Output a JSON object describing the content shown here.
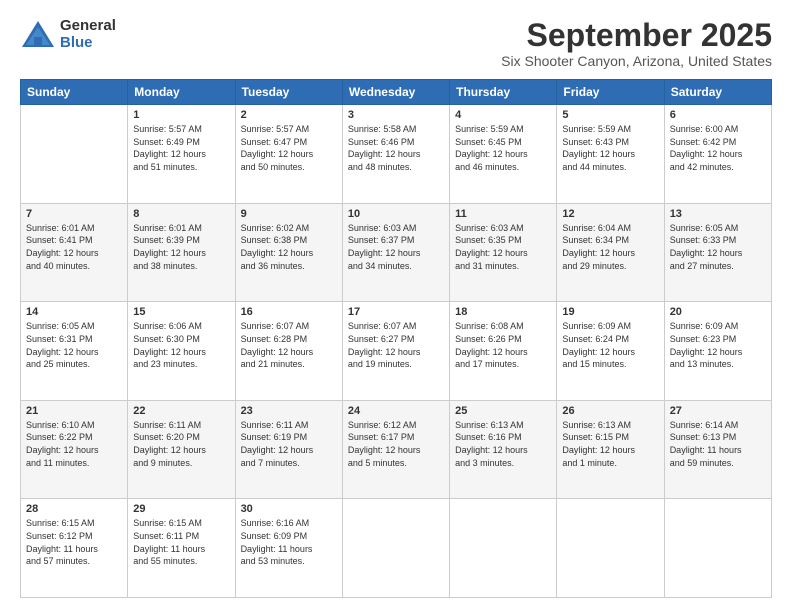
{
  "logo": {
    "general": "General",
    "blue": "Blue"
  },
  "title": "September 2025",
  "location": "Six Shooter Canyon, Arizona, United States",
  "days_of_week": [
    "Sunday",
    "Monday",
    "Tuesday",
    "Wednesday",
    "Thursday",
    "Friday",
    "Saturday"
  ],
  "weeks": [
    [
      {
        "day": "",
        "info": ""
      },
      {
        "day": "1",
        "info": "Sunrise: 5:57 AM\nSunset: 6:49 PM\nDaylight: 12 hours\nand 51 minutes."
      },
      {
        "day": "2",
        "info": "Sunrise: 5:57 AM\nSunset: 6:47 PM\nDaylight: 12 hours\nand 50 minutes."
      },
      {
        "day": "3",
        "info": "Sunrise: 5:58 AM\nSunset: 6:46 PM\nDaylight: 12 hours\nand 48 minutes."
      },
      {
        "day": "4",
        "info": "Sunrise: 5:59 AM\nSunset: 6:45 PM\nDaylight: 12 hours\nand 46 minutes."
      },
      {
        "day": "5",
        "info": "Sunrise: 5:59 AM\nSunset: 6:43 PM\nDaylight: 12 hours\nand 44 minutes."
      },
      {
        "day": "6",
        "info": "Sunrise: 6:00 AM\nSunset: 6:42 PM\nDaylight: 12 hours\nand 42 minutes."
      }
    ],
    [
      {
        "day": "7",
        "info": "Sunrise: 6:01 AM\nSunset: 6:41 PM\nDaylight: 12 hours\nand 40 minutes."
      },
      {
        "day": "8",
        "info": "Sunrise: 6:01 AM\nSunset: 6:39 PM\nDaylight: 12 hours\nand 38 minutes."
      },
      {
        "day": "9",
        "info": "Sunrise: 6:02 AM\nSunset: 6:38 PM\nDaylight: 12 hours\nand 36 minutes."
      },
      {
        "day": "10",
        "info": "Sunrise: 6:03 AM\nSunset: 6:37 PM\nDaylight: 12 hours\nand 34 minutes."
      },
      {
        "day": "11",
        "info": "Sunrise: 6:03 AM\nSunset: 6:35 PM\nDaylight: 12 hours\nand 31 minutes."
      },
      {
        "day": "12",
        "info": "Sunrise: 6:04 AM\nSunset: 6:34 PM\nDaylight: 12 hours\nand 29 minutes."
      },
      {
        "day": "13",
        "info": "Sunrise: 6:05 AM\nSunset: 6:33 PM\nDaylight: 12 hours\nand 27 minutes."
      }
    ],
    [
      {
        "day": "14",
        "info": "Sunrise: 6:05 AM\nSunset: 6:31 PM\nDaylight: 12 hours\nand 25 minutes."
      },
      {
        "day": "15",
        "info": "Sunrise: 6:06 AM\nSunset: 6:30 PM\nDaylight: 12 hours\nand 23 minutes."
      },
      {
        "day": "16",
        "info": "Sunrise: 6:07 AM\nSunset: 6:28 PM\nDaylight: 12 hours\nand 21 minutes."
      },
      {
        "day": "17",
        "info": "Sunrise: 6:07 AM\nSunset: 6:27 PM\nDaylight: 12 hours\nand 19 minutes."
      },
      {
        "day": "18",
        "info": "Sunrise: 6:08 AM\nSunset: 6:26 PM\nDaylight: 12 hours\nand 17 minutes."
      },
      {
        "day": "19",
        "info": "Sunrise: 6:09 AM\nSunset: 6:24 PM\nDaylight: 12 hours\nand 15 minutes."
      },
      {
        "day": "20",
        "info": "Sunrise: 6:09 AM\nSunset: 6:23 PM\nDaylight: 12 hours\nand 13 minutes."
      }
    ],
    [
      {
        "day": "21",
        "info": "Sunrise: 6:10 AM\nSunset: 6:22 PM\nDaylight: 12 hours\nand 11 minutes."
      },
      {
        "day": "22",
        "info": "Sunrise: 6:11 AM\nSunset: 6:20 PM\nDaylight: 12 hours\nand 9 minutes."
      },
      {
        "day": "23",
        "info": "Sunrise: 6:11 AM\nSunset: 6:19 PM\nDaylight: 12 hours\nand 7 minutes."
      },
      {
        "day": "24",
        "info": "Sunrise: 6:12 AM\nSunset: 6:17 PM\nDaylight: 12 hours\nand 5 minutes."
      },
      {
        "day": "25",
        "info": "Sunrise: 6:13 AM\nSunset: 6:16 PM\nDaylight: 12 hours\nand 3 minutes."
      },
      {
        "day": "26",
        "info": "Sunrise: 6:13 AM\nSunset: 6:15 PM\nDaylight: 12 hours\nand 1 minute."
      },
      {
        "day": "27",
        "info": "Sunrise: 6:14 AM\nSunset: 6:13 PM\nDaylight: 11 hours\nand 59 minutes."
      }
    ],
    [
      {
        "day": "28",
        "info": "Sunrise: 6:15 AM\nSunset: 6:12 PM\nDaylight: 11 hours\nand 57 minutes."
      },
      {
        "day": "29",
        "info": "Sunrise: 6:15 AM\nSunset: 6:11 PM\nDaylight: 11 hours\nand 55 minutes."
      },
      {
        "day": "30",
        "info": "Sunrise: 6:16 AM\nSunset: 6:09 PM\nDaylight: 11 hours\nand 53 minutes."
      },
      {
        "day": "",
        "info": ""
      },
      {
        "day": "",
        "info": ""
      },
      {
        "day": "",
        "info": ""
      },
      {
        "day": "",
        "info": ""
      }
    ]
  ]
}
